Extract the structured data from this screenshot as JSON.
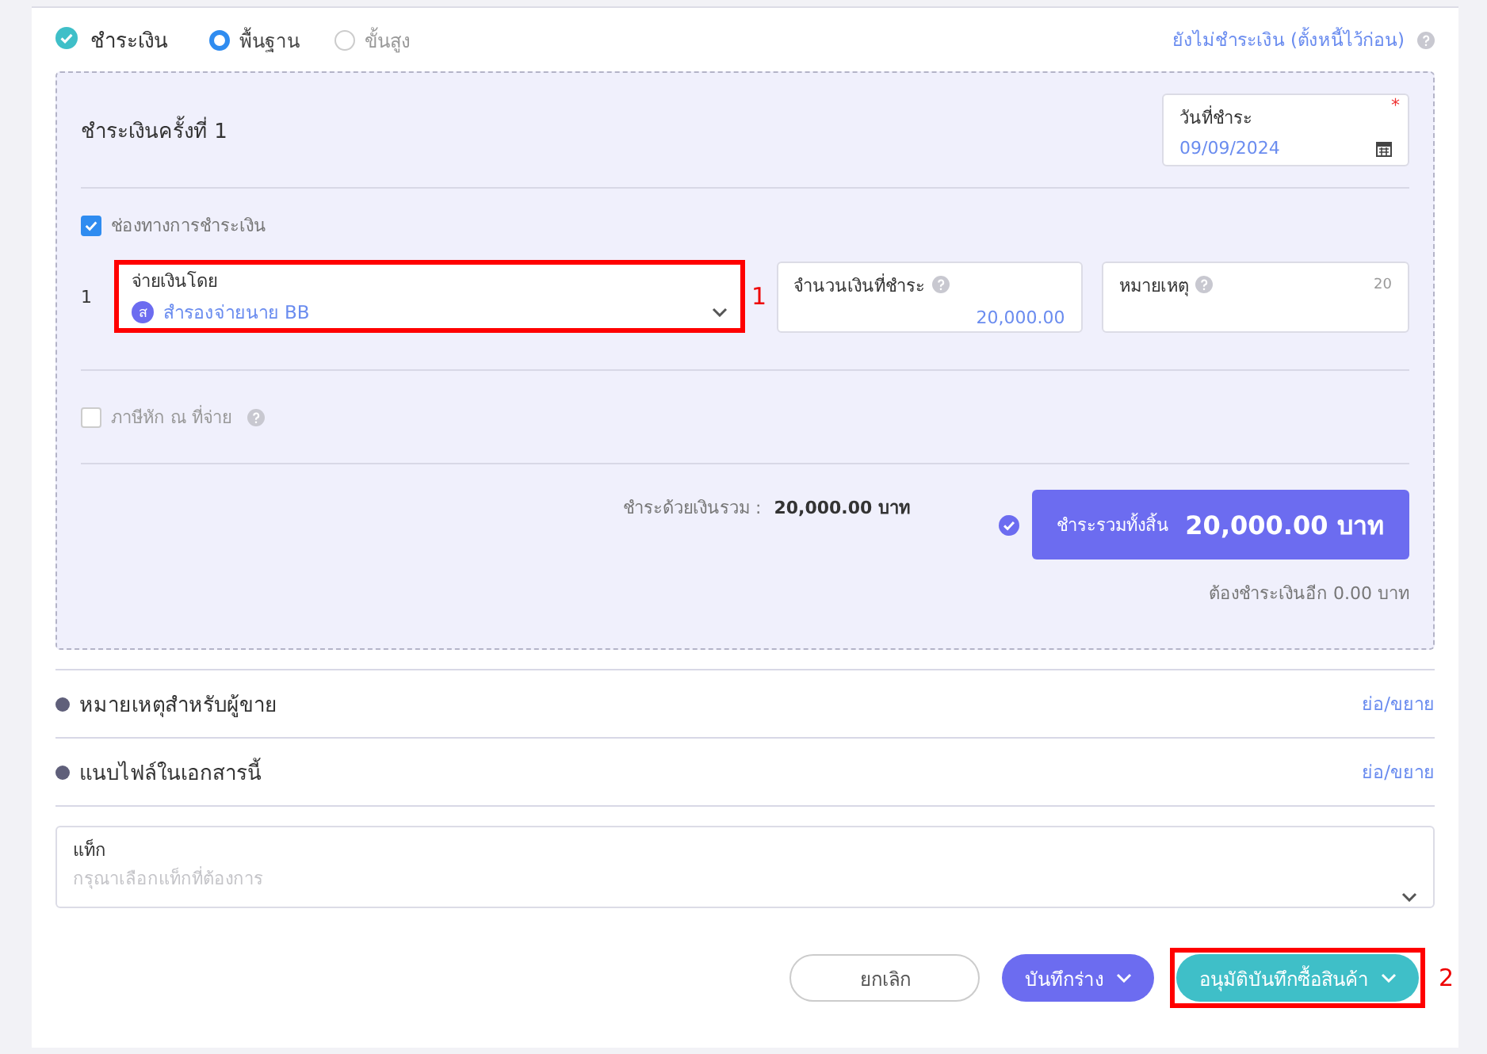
{
  "payment": {
    "checked": true,
    "title": "ชำระเงิน",
    "modes": [
      {
        "label": "พื้นฐาน",
        "selected": true
      },
      {
        "label": "ขั้นสูง",
        "selected": false
      }
    ],
    "defer_link": "ยังไม่ชำระเงิน (ตั้งหนี้ไว้ก่อน)"
  },
  "installment": {
    "title": "ชำระเงินครั้งที่ 1",
    "date": {
      "label": "วันที่ชำระ",
      "required_mark": "*",
      "value": "09/09/2024"
    },
    "channels": {
      "checked": true,
      "label": "ช่องทางการชำระเงิน"
    },
    "rows": [
      {
        "index": "1",
        "method": {
          "label": "จ่ายเงินโดย",
          "avatar": "ส",
          "value": "สำรองจ่ายนาย BB",
          "highlighted": true,
          "annotation": "1"
        },
        "amount": {
          "label": "จำนวนเงินที่ชำระ",
          "value": "20,000.00"
        },
        "note": {
          "label": "หมายเหตุ",
          "counter": "20"
        }
      }
    ],
    "withholding": {
      "checked": false,
      "label": "ภาษีหัก ณ ที่จ่าย"
    },
    "paid_label": "ชำระด้วยเงินรวม :",
    "paid_value": "20,000.00 บาท",
    "total_label": "ชำระรวมทั้งสิ้น",
    "total_value": "20,000.00 บาท",
    "remaining": "ต้องชำระเงินอีก 0.00 บาท"
  },
  "sections": [
    {
      "title": "หมายเหตุสำหรับผู้ขาย",
      "toggle": "ย่อ/ขยาย"
    },
    {
      "title": "แนบไฟล์ในเอกสารนี้",
      "toggle": "ย่อ/ขยาย"
    }
  ],
  "tag": {
    "label": "แท็ก",
    "placeholder": "กรุณาเลือกแท็กที่ต้องการ"
  },
  "buttons": [
    {
      "kind": "outline",
      "label": "ยกเลิก",
      "highlighted": false
    },
    {
      "kind": "primary",
      "label": "บันทึกร่าง",
      "highlighted": false
    },
    {
      "kind": "accent",
      "label": "อนุมัติบันทึกซื้อสินค้า",
      "highlighted": true,
      "annotation": "2"
    }
  ]
}
